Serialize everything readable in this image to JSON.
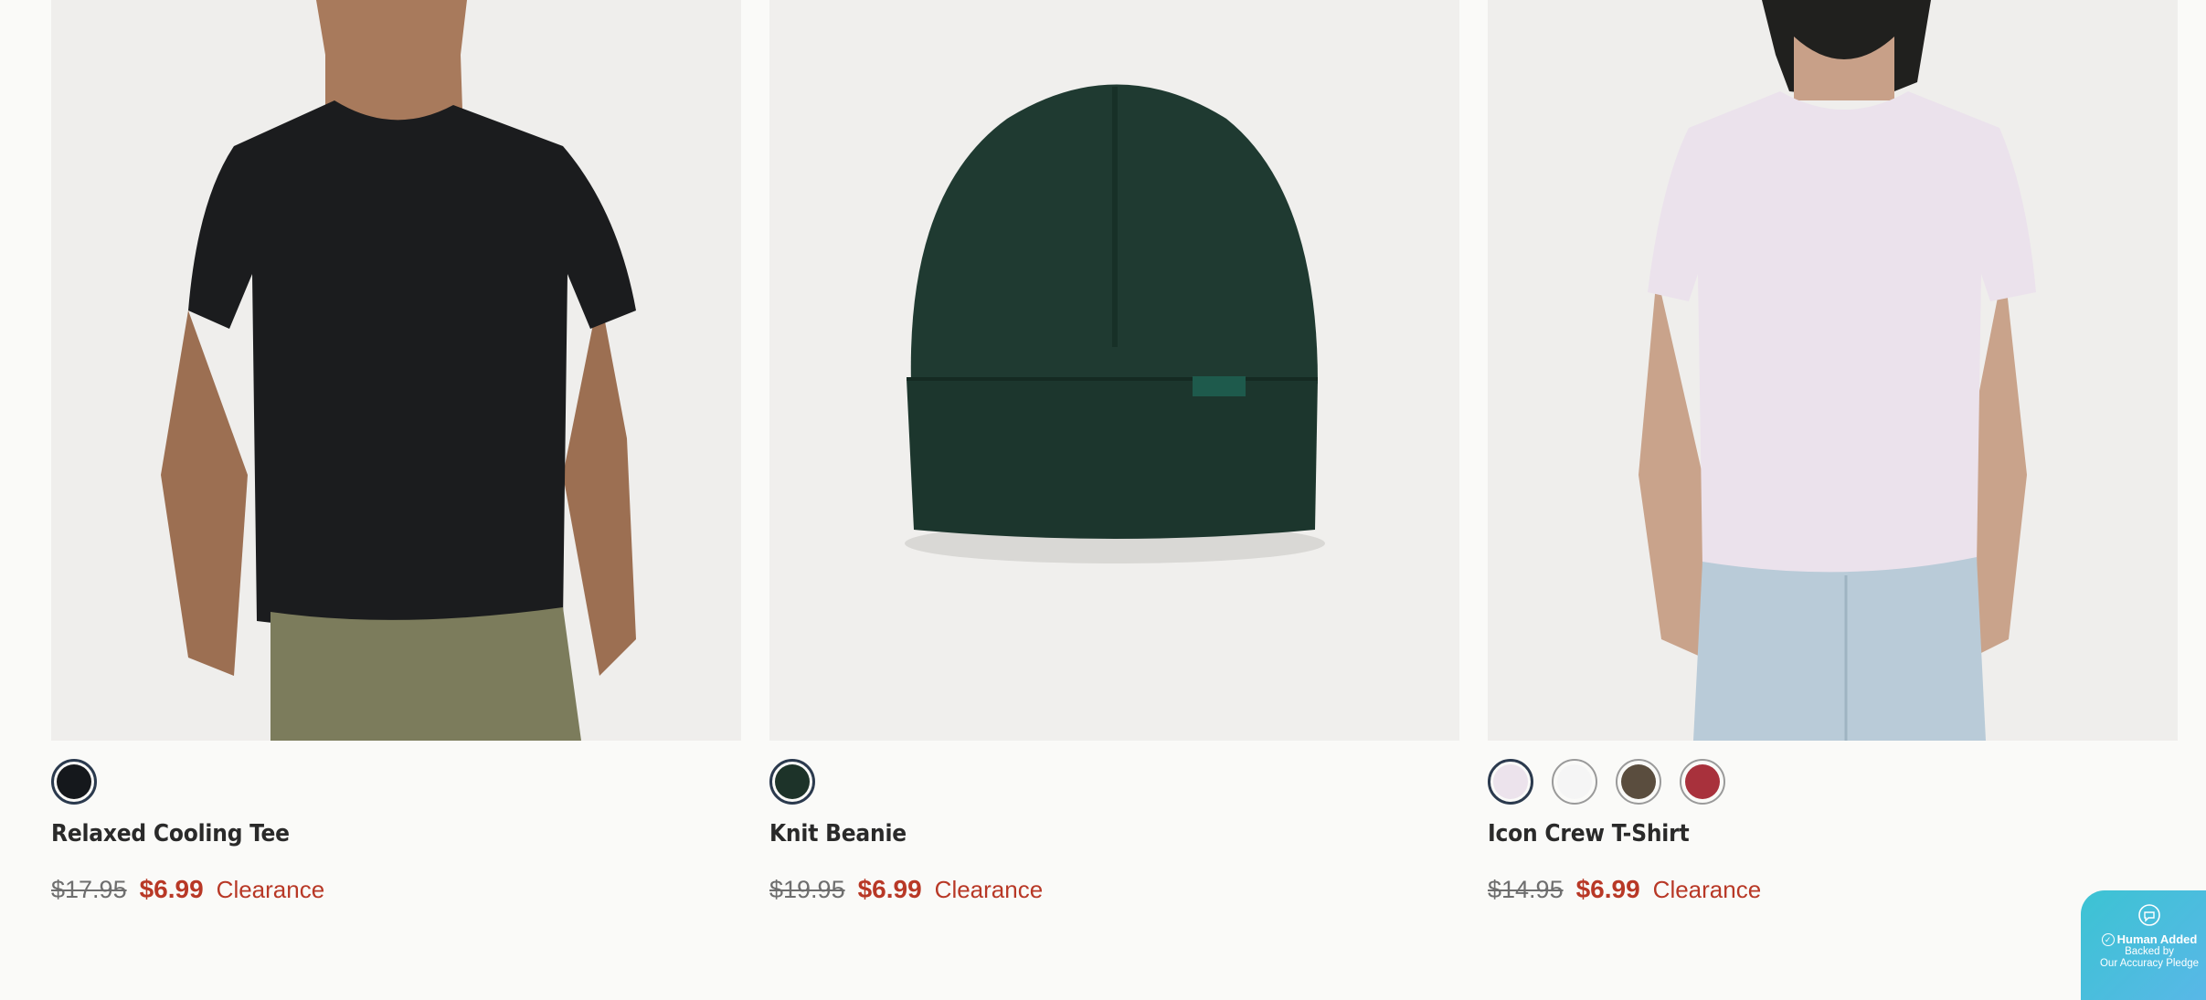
{
  "products": [
    {
      "name": "Relaxed Cooling Tee",
      "original_price": "$17.95",
      "sale_price": "$6.99",
      "tag": "Clearance",
      "swatches": [
        {
          "color": "#15181c",
          "selected": true
        }
      ]
    },
    {
      "name": "Knit Beanie",
      "original_price": "$19.95",
      "sale_price": "$6.99",
      "tag": "Clearance",
      "swatches": [
        {
          "color": "#1d3329",
          "selected": true
        }
      ]
    },
    {
      "name": "Icon Crew T-Shirt",
      "original_price": "$14.95",
      "sale_price": "$6.99",
      "tag": "Clearance",
      "swatches": [
        {
          "color": "#ece3ec",
          "selected": true
        },
        {
          "color": "#f5f5f5",
          "selected": false
        },
        {
          "color": "#5a4d3e",
          "selected": false
        },
        {
          "color": "#a8313c",
          "selected": false
        }
      ]
    }
  ],
  "badge": {
    "line1": "Human Added",
    "line2": "Backed by",
    "line3": "Our Accuracy Pledge",
    "icon": "chat-bubble-icon"
  },
  "colors": {
    "sale": "#b83826",
    "background": "#fafaf8",
    "photo_background": "#efeeec"
  }
}
